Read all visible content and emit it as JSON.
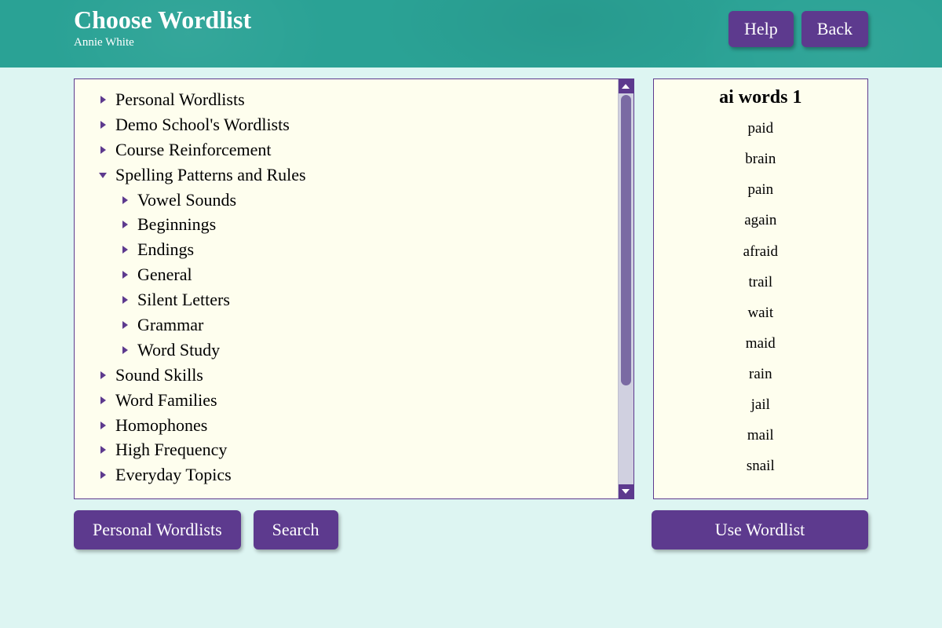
{
  "header": {
    "title": "Choose Wordlist",
    "subtitle": "Annie White",
    "help_label": "Help",
    "back_label": "Back"
  },
  "tree": {
    "nodes": [
      {
        "label": "Personal Wordlists",
        "expanded": false,
        "level": 0
      },
      {
        "label": "Demo School's Wordlists",
        "expanded": false,
        "level": 0
      },
      {
        "label": "Course Reinforcement",
        "expanded": false,
        "level": 0
      },
      {
        "label": "Spelling Patterns and Rules",
        "expanded": true,
        "level": 0
      },
      {
        "label": "Vowel Sounds",
        "expanded": false,
        "level": 1
      },
      {
        "label": "Beginnings",
        "expanded": false,
        "level": 1
      },
      {
        "label": "Endings",
        "expanded": false,
        "level": 1
      },
      {
        "label": "General",
        "expanded": false,
        "level": 1
      },
      {
        "label": "Silent Letters",
        "expanded": false,
        "level": 1
      },
      {
        "label": "Grammar",
        "expanded": false,
        "level": 1
      },
      {
        "label": "Word Study",
        "expanded": false,
        "level": 1
      },
      {
        "label": "Sound Skills",
        "expanded": false,
        "level": 0
      },
      {
        "label": "Word Families",
        "expanded": false,
        "level": 0
      },
      {
        "label": "Homophones",
        "expanded": false,
        "level": 0
      },
      {
        "label": "High Frequency",
        "expanded": false,
        "level": 0
      },
      {
        "label": "Everyday Topics",
        "expanded": false,
        "level": 0
      }
    ]
  },
  "preview": {
    "title": "ai words 1",
    "words": [
      "paid",
      "brain",
      "pain",
      "again",
      "afraid",
      "trail",
      "wait",
      "maid",
      "rain",
      "jail",
      "mail",
      "snail"
    ]
  },
  "buttons": {
    "personal_label": "Personal Wordlists",
    "search_label": "Search",
    "use_label": "Use Wordlist"
  },
  "colors": {
    "header_bg": "#2aa295",
    "body_bg": "#ddf5f2",
    "panel_bg": "#fefeee",
    "accent": "#5d3a8e"
  }
}
